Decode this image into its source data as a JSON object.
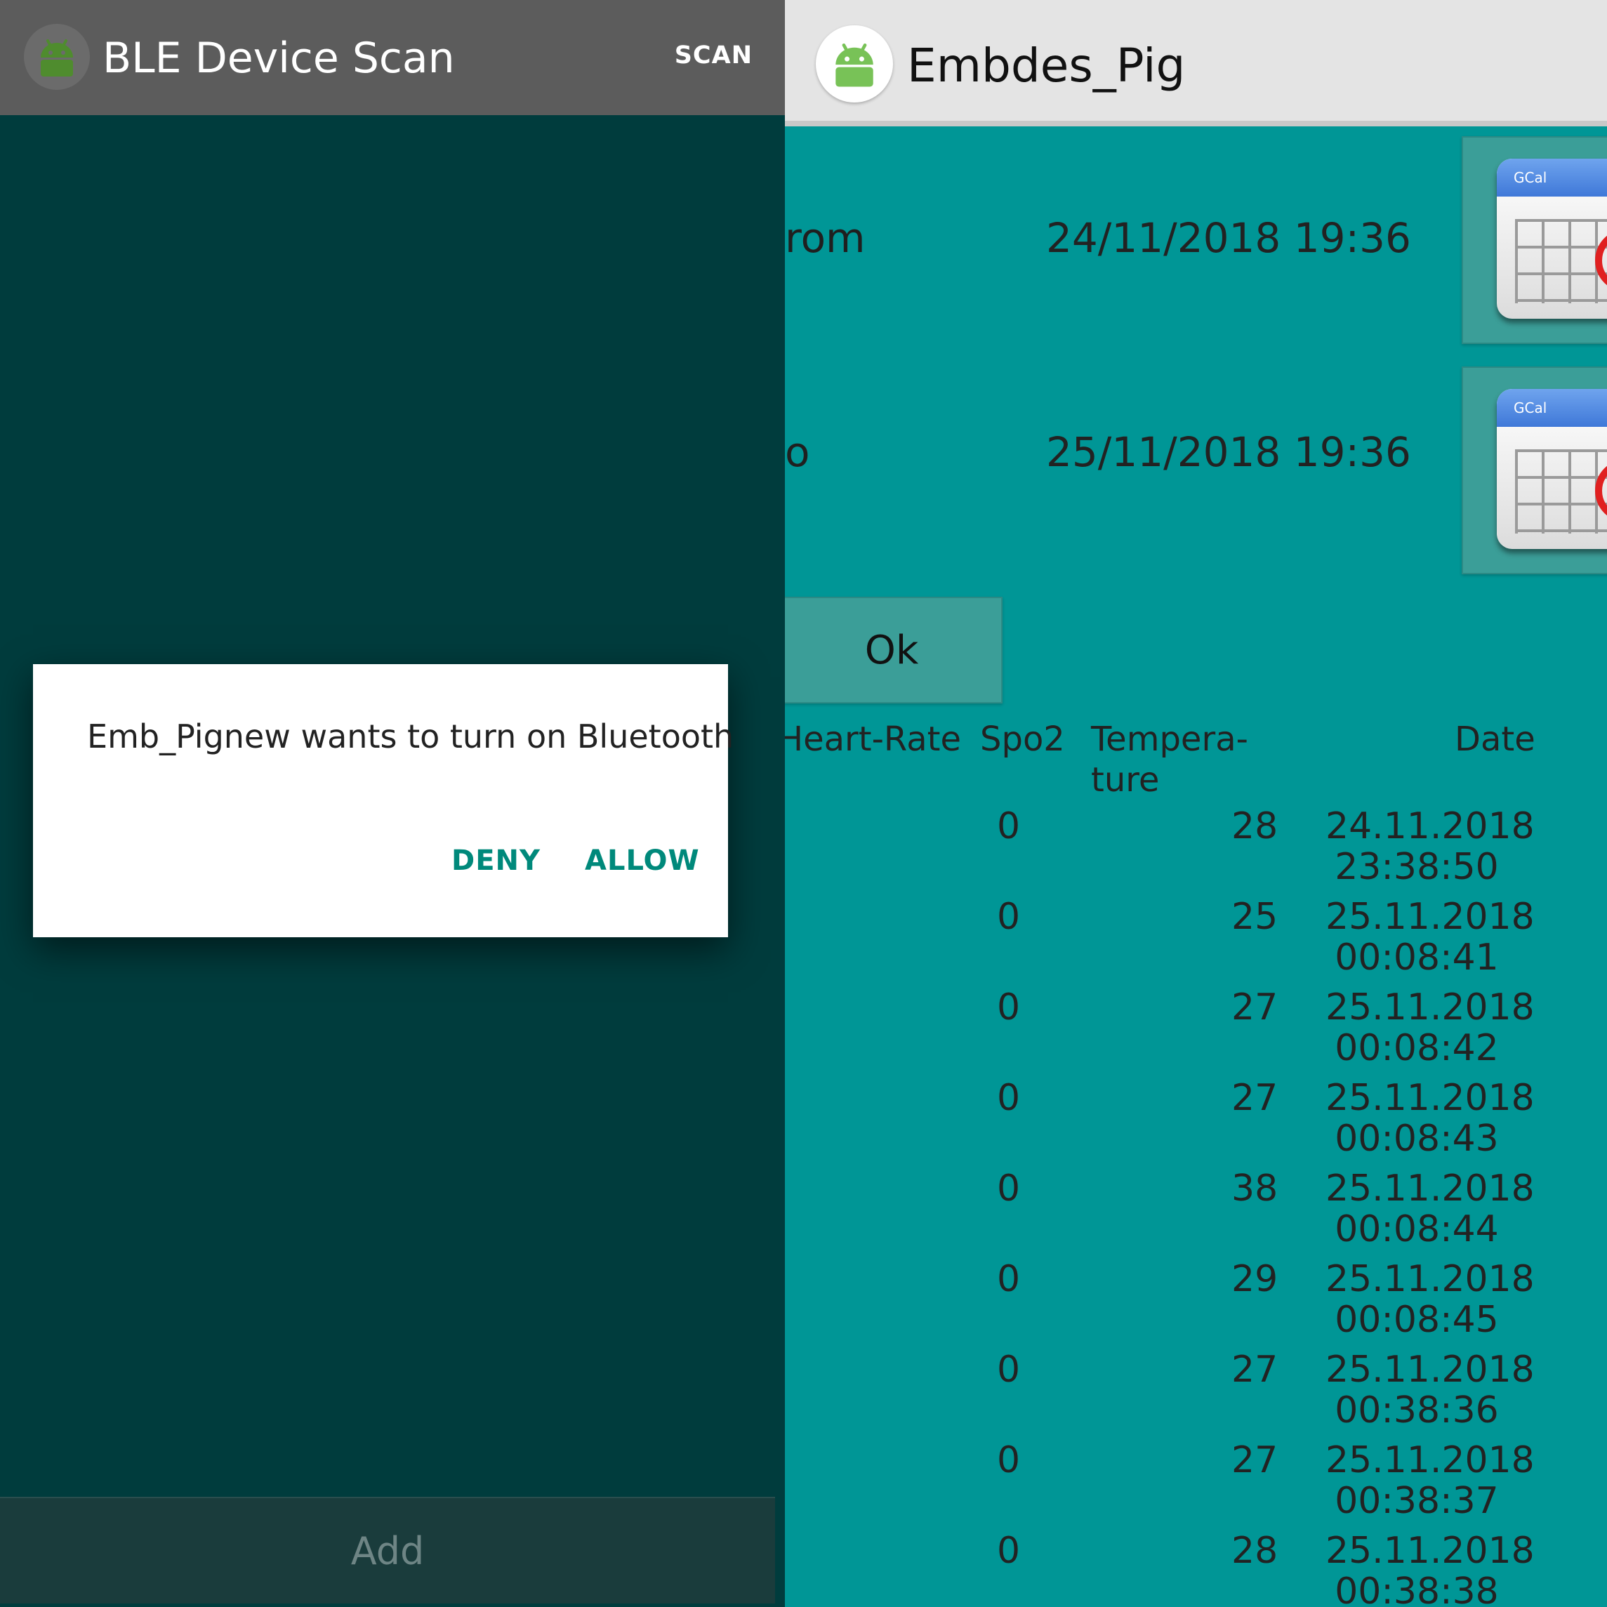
{
  "left": {
    "title": "BLE Device Scan",
    "scan_label": "SCAN",
    "dialog": {
      "message": "Emb_Pignew wants to turn on Bluetooth",
      "deny": "DENY",
      "allow": "ALLOW"
    },
    "add_label": "Add"
  },
  "right": {
    "title": "Embdes_Pig",
    "from": {
      "label": "rom",
      "datetime": "24/11/2018 19:36",
      "calendar_caption": "GCal"
    },
    "to": {
      "label": "o",
      "datetime": "25/11/2018 19:36",
      "calendar_caption": "GCal"
    },
    "ok_label": "Ok",
    "table": {
      "headers": {
        "heart_rate": "Heart-Rate",
        "spo2": "Spo2",
        "temperature_1": "Tempera-",
        "temperature_2": "ture",
        "date": "Date"
      },
      "rows": [
        {
          "spo2": "0",
          "temp": "28",
          "date": "24.11.2018",
          "time": "23:38:50"
        },
        {
          "spo2": "0",
          "temp": "25",
          "date": "25.11.2018",
          "time": "00:08:41"
        },
        {
          "spo2": "0",
          "temp": "27",
          "date": "25.11.2018",
          "time": "00:08:42"
        },
        {
          "spo2": "0",
          "temp": "27",
          "date": "25.11.2018",
          "time": "00:08:43"
        },
        {
          "spo2": "0",
          "temp": "38",
          "date": "25.11.2018",
          "time": "00:08:44"
        },
        {
          "spo2": "0",
          "temp": "29",
          "date": "25.11.2018",
          "time": "00:08:45"
        },
        {
          "spo2": "0",
          "temp": "27",
          "date": "25.11.2018",
          "time": "00:38:36"
        },
        {
          "spo2": "0",
          "temp": "27",
          "date": "25.11.2018",
          "time": "00:38:37"
        },
        {
          "spo2": "0",
          "temp": "28",
          "date": "25.11.2018",
          "time": "00:38:38"
        }
      ]
    }
  },
  "colors": {
    "left_background": "#003c3d",
    "left_appbar": "#5c5c5c",
    "right_background": "#009696",
    "right_appbar": "#e4e4e4",
    "dialog_accent": "#00897b",
    "android_green": "#78c257"
  },
  "icons": {
    "left_app": "android-icon",
    "right_app": "android-icon",
    "calendar": "calendar-icon"
  }
}
